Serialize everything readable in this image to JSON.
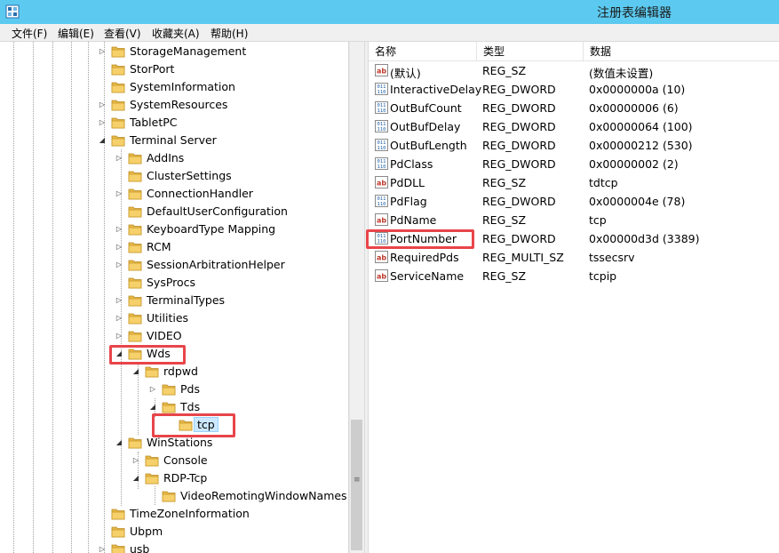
{
  "window": {
    "title": "注册表编辑器"
  },
  "menu": [
    "文件(F)",
    "编辑(E)",
    "查看(V)",
    "收藏夹(A)",
    "帮助(H)"
  ],
  "tree": [
    {
      "label": "StorageManagement",
      "level": 0,
      "expander": "closed"
    },
    {
      "label": "StorPort",
      "level": 0,
      "expander": "none"
    },
    {
      "label": "SystemInformation",
      "level": 0,
      "expander": "none"
    },
    {
      "label": "SystemResources",
      "level": 0,
      "expander": "closed"
    },
    {
      "label": "TabletPC",
      "level": 0,
      "expander": "closed"
    },
    {
      "label": "Terminal Server",
      "level": 0,
      "expander": "open"
    },
    {
      "label": "AddIns",
      "level": 1,
      "expander": "closed"
    },
    {
      "label": "ClusterSettings",
      "level": 1,
      "expander": "none"
    },
    {
      "label": "ConnectionHandler",
      "level": 1,
      "expander": "closed"
    },
    {
      "label": "DefaultUserConfiguration",
      "level": 1,
      "expander": "none"
    },
    {
      "label": "KeyboardType Mapping",
      "level": 1,
      "expander": "closed"
    },
    {
      "label": "RCM",
      "level": 1,
      "expander": "closed"
    },
    {
      "label": "SessionArbitrationHelper",
      "level": 1,
      "expander": "closed"
    },
    {
      "label": "SysProcs",
      "level": 1,
      "expander": "none"
    },
    {
      "label": "TerminalTypes",
      "level": 1,
      "expander": "closed"
    },
    {
      "label": "Utilities",
      "level": 1,
      "expander": "closed"
    },
    {
      "label": "VIDEO",
      "level": 1,
      "expander": "closed"
    },
    {
      "label": "Wds",
      "level": 1,
      "expander": "open"
    },
    {
      "label": "rdpwd",
      "level": 2,
      "expander": "open"
    },
    {
      "label": "Pds",
      "level": 3,
      "expander": "closed"
    },
    {
      "label": "Tds",
      "level": 3,
      "expander": "open"
    },
    {
      "label": "tcp",
      "level": 4,
      "expander": "none",
      "selected": true
    },
    {
      "label": "WinStations",
      "level": 1,
      "expander": "open"
    },
    {
      "label": "Console",
      "level": 2,
      "expander": "closed"
    },
    {
      "label": "RDP-Tcp",
      "level": 2,
      "expander": "open"
    },
    {
      "label": "VideoRemotingWindowNames",
      "level": 3,
      "expander": "none"
    },
    {
      "label": "TimeZoneInformation",
      "level": 0,
      "expander": "none"
    },
    {
      "label": "Ubpm",
      "level": 0,
      "expander": "none"
    },
    {
      "label": "usb",
      "level": 0,
      "expander": "closed"
    }
  ],
  "list": {
    "columns": [
      "名称",
      "类型",
      "数据"
    ],
    "rows": [
      {
        "name": "(默认)",
        "type": "REG_SZ",
        "data": "(数值未设置)",
        "icon": "string-value-icon"
      },
      {
        "name": "InteractiveDelay",
        "type": "REG_DWORD",
        "data": "0x0000000a (10)",
        "icon": "binary-value-icon"
      },
      {
        "name": "OutBufCount",
        "type": "REG_DWORD",
        "data": "0x00000006 (6)",
        "icon": "binary-value-icon"
      },
      {
        "name": "OutBufDelay",
        "type": "REG_DWORD",
        "data": "0x00000064 (100)",
        "icon": "binary-value-icon"
      },
      {
        "name": "OutBufLength",
        "type": "REG_DWORD",
        "data": "0x00000212 (530)",
        "icon": "binary-value-icon"
      },
      {
        "name": "PdClass",
        "type": "REG_DWORD",
        "data": "0x00000002 (2)",
        "icon": "binary-value-icon"
      },
      {
        "name": "PdDLL",
        "type": "REG_SZ",
        "data": "tdtcp",
        "icon": "string-value-icon"
      },
      {
        "name": "PdFlag",
        "type": "REG_DWORD",
        "data": "0x0000004e (78)",
        "icon": "binary-value-icon"
      },
      {
        "name": "PdName",
        "type": "REG_SZ",
        "data": "tcp",
        "icon": "string-value-icon"
      },
      {
        "name": "PortNumber",
        "type": "REG_DWORD",
        "data": "0x00000d3d (3389)",
        "icon": "binary-value-icon"
      },
      {
        "name": "RequiredPds",
        "type": "REG_MULTI_SZ",
        "data": "tssecsrv",
        "icon": "string-value-icon"
      },
      {
        "name": "ServiceName",
        "type": "REG_SZ",
        "data": "tcpip",
        "icon": "string-value-icon"
      }
    ]
  },
  "colors": {
    "titlebar": "#5ccaf0",
    "highlight_box": "#e8454a",
    "selection": "#cce8ff"
  }
}
